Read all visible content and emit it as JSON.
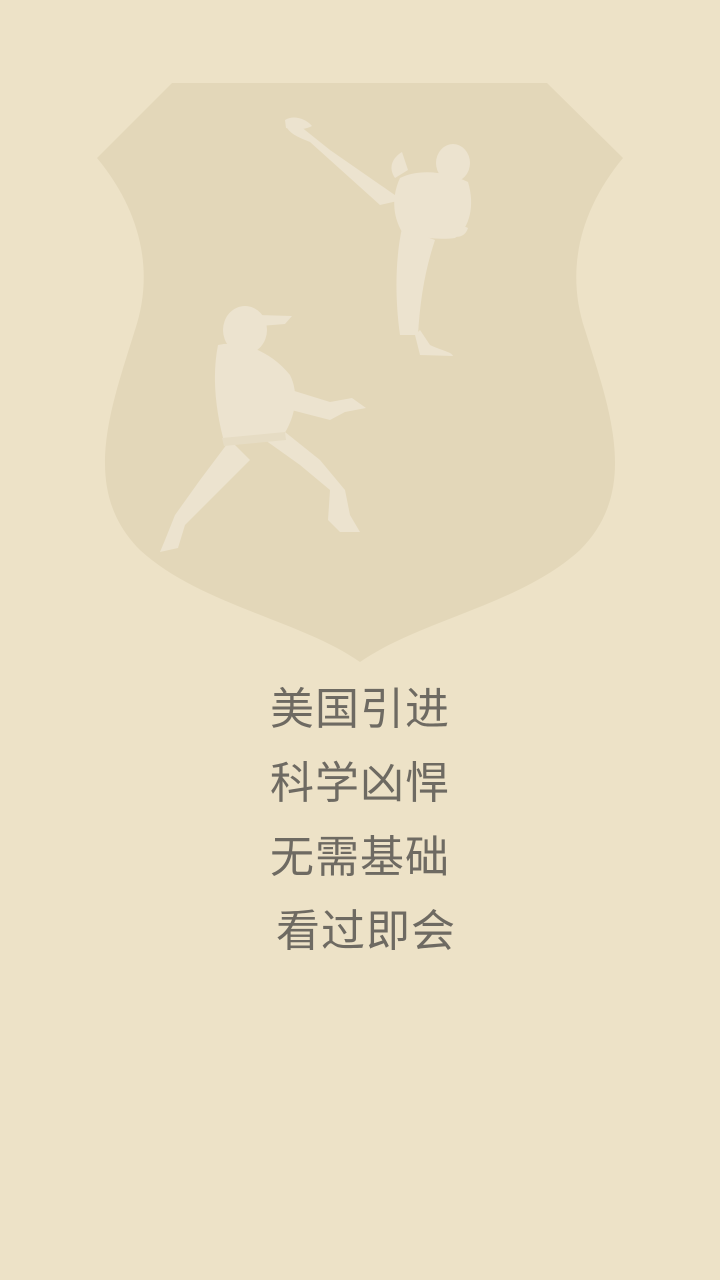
{
  "splash": {
    "logo": "karate-fighters-shield",
    "taglines": [
      "美国引进",
      "科学凶悍",
      "无需基础",
      "看过即会"
    ]
  },
  "colors": {
    "background": "#ede2c7",
    "shield": "#e3d7b9",
    "silhouette": "#ece3cf",
    "text": "#6e6a62"
  }
}
